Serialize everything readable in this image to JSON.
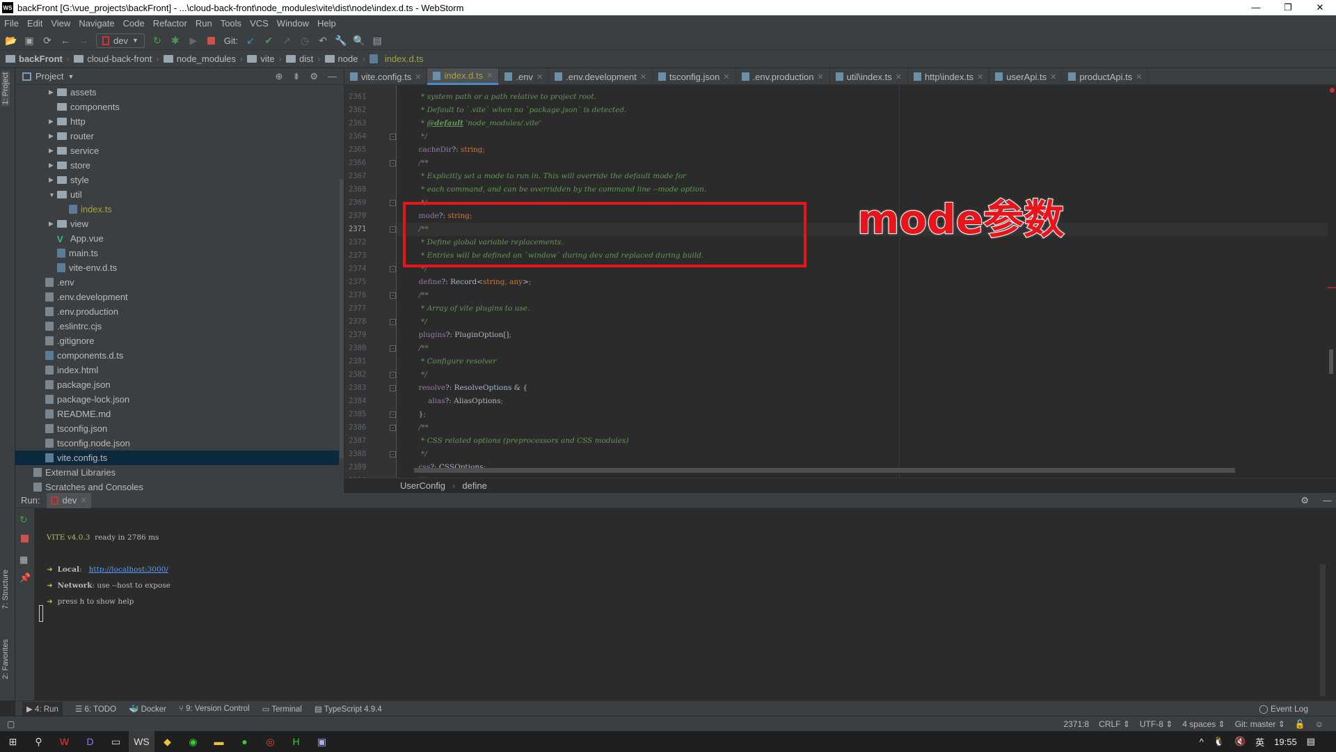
{
  "window": {
    "title": "backFront [G:\\vue_projects\\backFront] - ...\\cloud-back-front\\node_modules\\vite\\dist\\node\\index.d.ts - WebStorm",
    "logo": "WS",
    "minimize": "—",
    "restore": "❐",
    "close": "✕"
  },
  "menu": [
    "File",
    "Edit",
    "View",
    "Navigate",
    "Code",
    "Refactor",
    "Run",
    "Tools",
    "VCS",
    "Window",
    "Help"
  ],
  "toolbar": {
    "run_config": "dev",
    "git_label": "Git:"
  },
  "breadcrumb": [
    "backFront",
    "cloud-back-front",
    "node_modules",
    "vite",
    "dist",
    "node",
    "index.d.ts"
  ],
  "left_strip": {
    "project": "1: Project",
    "structure": "7: Structure",
    "favorites": "2: Favorites"
  },
  "project": {
    "title": "Project",
    "items": [
      {
        "label": "assets",
        "type": "dir",
        "depth": 2,
        "arrow": "▶"
      },
      {
        "label": "components",
        "type": "dir",
        "depth": 2,
        "arrow": ""
      },
      {
        "label": "http",
        "type": "dir",
        "depth": 2,
        "arrow": "▶"
      },
      {
        "label": "router",
        "type": "dir",
        "depth": 2,
        "arrow": "▶"
      },
      {
        "label": "service",
        "type": "dir",
        "depth": 2,
        "arrow": "▶"
      },
      {
        "label": "store",
        "type": "dir",
        "depth": 2,
        "arrow": "▶"
      },
      {
        "label": "style",
        "type": "dir",
        "depth": 2,
        "arrow": "▶"
      },
      {
        "label": "util",
        "type": "dir",
        "depth": 2,
        "arrow": "▼"
      },
      {
        "label": "index.ts",
        "type": "ts",
        "depth": 3,
        "arrow": "",
        "color": "#a5a53a"
      },
      {
        "label": "view",
        "type": "dir",
        "depth": 2,
        "arrow": "▶"
      },
      {
        "label": "App.vue",
        "type": "vue",
        "depth": 2,
        "arrow": ""
      },
      {
        "label": "main.ts",
        "type": "ts",
        "depth": 2,
        "arrow": ""
      },
      {
        "label": "vite-env.d.ts",
        "type": "ts",
        "depth": 2,
        "arrow": ""
      },
      {
        "label": ".env",
        "type": "file",
        "depth": 1,
        "arrow": ""
      },
      {
        "label": ".env.development",
        "type": "file",
        "depth": 1,
        "arrow": ""
      },
      {
        "label": ".env.production",
        "type": "file",
        "depth": 1,
        "arrow": ""
      },
      {
        "label": ".eslintrc.cjs",
        "type": "file",
        "depth": 1,
        "arrow": ""
      },
      {
        "label": ".gitignore",
        "type": "file",
        "depth": 1,
        "arrow": ""
      },
      {
        "label": "components.d.ts",
        "type": "ts",
        "depth": 1,
        "arrow": ""
      },
      {
        "label": "index.html",
        "type": "file",
        "depth": 1,
        "arrow": ""
      },
      {
        "label": "package.json",
        "type": "file",
        "depth": 1,
        "arrow": ""
      },
      {
        "label": "package-lock.json",
        "type": "file",
        "depth": 1,
        "arrow": ""
      },
      {
        "label": "README.md",
        "type": "file",
        "depth": 1,
        "arrow": ""
      },
      {
        "label": "tsconfig.json",
        "type": "file",
        "depth": 1,
        "arrow": ""
      },
      {
        "label": "tsconfig.node.json",
        "type": "file",
        "depth": 1,
        "arrow": ""
      },
      {
        "label": "vite.config.ts",
        "type": "ts",
        "depth": 1,
        "arrow": "",
        "selected": true
      },
      {
        "label": "External Libraries",
        "type": "lib",
        "depth": 0,
        "arrow": ""
      },
      {
        "label": "Scratches and Consoles",
        "type": "lib",
        "depth": 0,
        "arrow": ""
      }
    ]
  },
  "tabs": [
    {
      "label": "vite.config.ts"
    },
    {
      "label": "index.d.ts",
      "active": true
    },
    {
      "label": ".env"
    },
    {
      "label": ".env.development"
    },
    {
      "label": "tsconfig.json"
    },
    {
      "label": ".env.production"
    },
    {
      "label": "util\\index.ts"
    },
    {
      "label": "http\\index.ts"
    },
    {
      "label": "userApi.ts"
    },
    {
      "label": "productApi.ts"
    }
  ],
  "editor": {
    "current_line": 2371,
    "lines": [
      {
        "n": 2361,
        "s": [
          [
            "c",
            "   * system path or a path relative to project root."
          ]
        ]
      },
      {
        "n": 2362,
        "s": [
          [
            "c",
            "   * Default to `.vite` when no `package.json` is detected."
          ]
        ]
      },
      {
        "n": 2363,
        "s": [
          [
            "c",
            "   * "
          ],
          [
            "d",
            "@default"
          ],
          [
            "c",
            " 'node_modules/.vite'"
          ]
        ]
      },
      {
        "n": 2364,
        "f": 1,
        "s": [
          [
            "c",
            "   */"
          ]
        ]
      },
      {
        "n": 2365,
        "s": [
          [
            "p",
            "  cacheDir"
          ],
          [
            "t",
            "?: "
          ],
          [
            "k",
            "string;"
          ]
        ]
      },
      {
        "n": 2366,
        "f": 1,
        "s": [
          [
            "c",
            "  /**"
          ]
        ]
      },
      {
        "n": 2367,
        "s": [
          [
            "c",
            "   * Explicitly set a mode to run in. This will override the default mode for"
          ]
        ]
      },
      {
        "n": 2368,
        "s": [
          [
            "c",
            "   * each command, and can be overridden by the command line --mode option."
          ]
        ]
      },
      {
        "n": 2369,
        "f": 1,
        "s": [
          [
            "c",
            "   */"
          ]
        ]
      },
      {
        "n": 2370,
        "s": [
          [
            "p",
            "  mode"
          ],
          [
            "t",
            "?: "
          ],
          [
            "k",
            "string;"
          ]
        ]
      },
      {
        "n": 2371,
        "f": 1,
        "s": [
          [
            "c",
            "  /**"
          ]
        ]
      },
      {
        "n": 2372,
        "s": [
          [
            "c",
            "   * Define global variable replacements."
          ]
        ]
      },
      {
        "n": 2373,
        "s": [
          [
            "c",
            "   * Entries will be defined on `window` during dev and replaced during build."
          ]
        ]
      },
      {
        "n": 2374,
        "f": 1,
        "s": [
          [
            "c",
            "   */"
          ]
        ]
      },
      {
        "n": 2375,
        "s": [
          [
            "p",
            "  define"
          ],
          [
            "t",
            "?: Record<"
          ],
          [
            "k",
            "string, any"
          ],
          [
            "t",
            ">"
          ],
          [
            "k",
            ";"
          ]
        ]
      },
      {
        "n": 2376,
        "f": 1,
        "s": [
          [
            "c",
            "  /**"
          ]
        ]
      },
      {
        "n": 2377,
        "s": [
          [
            "c",
            "   * Array of vite plugins to use."
          ]
        ]
      },
      {
        "n": 2378,
        "f": 1,
        "s": [
          [
            "c",
            "   */"
          ]
        ]
      },
      {
        "n": 2379,
        "s": [
          [
            "p",
            "  plugins"
          ],
          [
            "t",
            "?: PluginOption[]"
          ],
          [
            "k",
            ";"
          ]
        ]
      },
      {
        "n": 2380,
        "f": 1,
        "s": [
          [
            "c",
            "  /**"
          ]
        ]
      },
      {
        "n": 2381,
        "s": [
          [
            "c",
            "   * Configure resolver"
          ]
        ]
      },
      {
        "n": 2382,
        "f": 1,
        "s": [
          [
            "c",
            "   */"
          ]
        ]
      },
      {
        "n": 2383,
        "f": 1,
        "s": [
          [
            "p",
            "  resolve"
          ],
          [
            "t",
            "?: ResolveOptions & {"
          ]
        ]
      },
      {
        "n": 2384,
        "s": [
          [
            "p",
            "      alias"
          ],
          [
            "t",
            "?: AliasOptions"
          ],
          [
            "k",
            ";"
          ]
        ]
      },
      {
        "n": 2385,
        "f": 1,
        "s": [
          [
            "t",
            "  }"
          ],
          [
            "k",
            ";"
          ]
        ]
      },
      {
        "n": 2386,
        "f": 1,
        "s": [
          [
            "c",
            "  /**"
          ]
        ]
      },
      {
        "n": 2387,
        "s": [
          [
            "c",
            "   * CSS related options (preprocessors and CSS modules)"
          ]
        ]
      },
      {
        "n": 2388,
        "f": 1,
        "s": [
          [
            "c",
            "   */"
          ]
        ]
      },
      {
        "n": 2389,
        "s": [
          [
            "p",
            "  css"
          ],
          [
            "t",
            "?: CSSOptions"
          ],
          [
            "k",
            ";"
          ]
        ]
      },
      {
        "n": 2390,
        "f": 1,
        "s": [
          [
            "c",
            "  /**"
          ]
        ]
      }
    ]
  },
  "annotation": "mode参数",
  "editor_breadcrumb": [
    "UserConfig",
    "define"
  ],
  "run": {
    "label": "Run:",
    "tab": "dev",
    "console": {
      "vite": "VITE v4.0.3",
      "ready": "  ready in 2786 ms",
      "dash": "➜",
      "local_label": "Local",
      "local_url": "http://localhost:3000/",
      "network_label": "Network",
      "network_text": ": use --host to expose",
      "help": "press h to show help"
    }
  },
  "bottom_tabs": [
    "4: Run",
    "6: TODO",
    "Docker",
    "9: Version Control",
    "Terminal",
    "TypeScript 4.9.4"
  ],
  "event_log": "Event Log",
  "status": {
    "position": "2371:8",
    "line_sep": "CRLF ⇕",
    "encoding": "UTF-8 ⇕",
    "indent": "4 spaces ⇕",
    "git": "Git: master ⇕"
  },
  "taskbar": {
    "ime": "英",
    "time": "19:55"
  }
}
